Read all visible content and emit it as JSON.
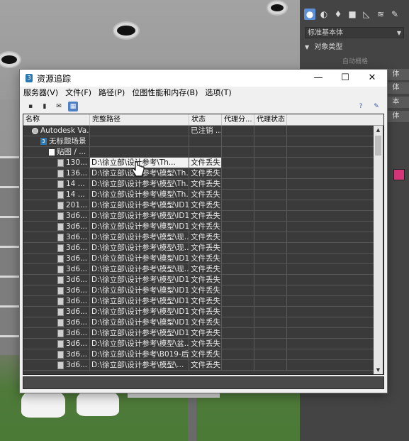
{
  "window": {
    "title": "资源追踪",
    "min_glyph": "—",
    "max_glyph": "☐",
    "close_glyph": "✕"
  },
  "menu": [
    "服务器(V)",
    "文件(F)",
    "路径(P)",
    "位图性能和内存(B)",
    "选项(T)"
  ],
  "columns": [
    "名称",
    "完整路径",
    "状态",
    "代理分...",
    "代理状态"
  ],
  "tree": [
    {
      "name": "Autodesk Va...",
      "status": "已注销 ..."
    },
    {
      "name": "无标题场景",
      "status": ""
    },
    {
      "name": "贴图 / ...",
      "status": ""
    }
  ],
  "files": [
    {
      "name": "130...",
      "path": "D:\\徐立部\\设计参考\\Th...",
      "status": "文件丢失"
    },
    {
      "name": "136...",
      "path": "D:\\徐立部\\设计参考\\模型\\Th...",
      "status": "文件丢失"
    },
    {
      "name": "14 ...",
      "path": "D:\\徐立部\\设计参考\\模型\\Th...",
      "status": "文件丢失"
    },
    {
      "name": "14 ...",
      "path": "D:\\徐立部\\设计参考\\模型\\Th...",
      "status": "文件丢失"
    },
    {
      "name": "201...",
      "path": "D:\\徐立部\\设计参考\\模型\\ID1...",
      "status": "文件丢失"
    },
    {
      "name": "3d6...",
      "path": "D:\\徐立部\\设计参考\\模型\\ID1...",
      "status": "文件丢失"
    },
    {
      "name": "3d6...",
      "path": "D:\\徐立部\\设计参考\\模型\\ID1...",
      "status": "文件丢失"
    },
    {
      "name": "3d6...",
      "path": "D:\\徐立部\\设计参考\\模型\\现...",
      "status": "文件丢失"
    },
    {
      "name": "3d6...",
      "path": "D:\\徐立部\\设计参考\\模型\\现...",
      "status": "文件丢失"
    },
    {
      "name": "3d6...",
      "path": "D:\\徐立部\\设计参考\\模型\\ID1...",
      "status": "文件丢失"
    },
    {
      "name": "3d6...",
      "path": "D:\\徐立部\\设计参考\\模型\\现...",
      "status": "文件丢失"
    },
    {
      "name": "3d6...",
      "path": "D:\\徐立部\\设计参考\\模型\\ID1...",
      "status": "文件丢失"
    },
    {
      "name": "3d6...",
      "path": "D:\\徐立部\\设计参考\\模型\\ID1...",
      "status": "文件丢失"
    },
    {
      "name": "3d6...",
      "path": "D:\\徐立部\\设计参考\\模型\\ID1...",
      "status": "文件丢失"
    },
    {
      "name": "3d6...",
      "path": "D:\\徐立部\\设计参考\\模型\\ID1...",
      "status": "文件丢失"
    },
    {
      "name": "3d6...",
      "path": "D:\\徐立部\\设计参考\\模型\\ID1...",
      "status": "文件丢失"
    },
    {
      "name": "3d6...",
      "path": "D:\\徐立部\\设计参考\\模型\\ID1...",
      "status": "文件丢失"
    },
    {
      "name": "3d6...",
      "path": "D:\\徐立部\\设计参考\\模型\\盆...",
      "status": "文件丢失"
    },
    {
      "name": "3d6...",
      "path": "D:\\徐立部\\设计参考\\B019-后...",
      "status": "文件丢失"
    },
    {
      "name": "3d6...",
      "path": "D:\\徐立部\\设计参考\\模型\\...",
      "status": "文件丢失"
    }
  ],
  "highlighted_row": 0,
  "command_panel": {
    "dropdown": "标准基本体",
    "rollout_title": "对象类型",
    "autogrid": "自动栅格",
    "buttons": [
      "体",
      "体",
      "本",
      "体"
    ],
    "swatch_color": "#d7357a"
  }
}
